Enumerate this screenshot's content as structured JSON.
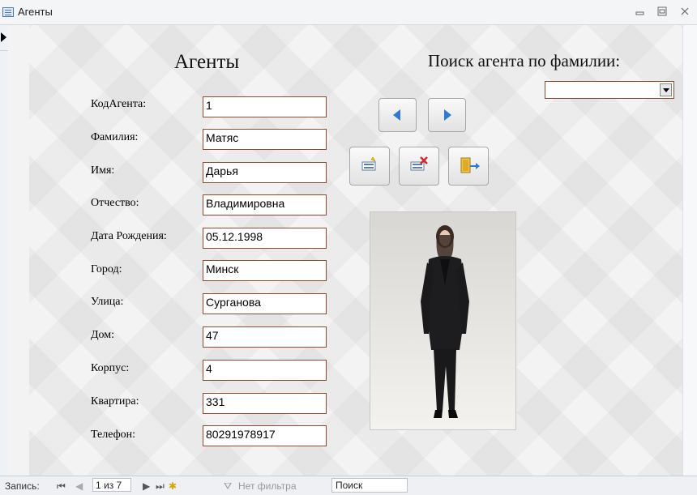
{
  "window": {
    "title": "Агенты"
  },
  "form": {
    "title": "Агенты",
    "search_label": "Поиск агента по фамилии:",
    "search_value": "",
    "fields": [
      {
        "label": "КодАгента:",
        "value": "1"
      },
      {
        "label": "Фамилия:",
        "value": "Матяс"
      },
      {
        "label": "Имя:",
        "value": "Дарья"
      },
      {
        "label": "Отчество:",
        "value": "Владимировна"
      },
      {
        "label": "Дата Рождения:",
        "value": "05.12.1998"
      },
      {
        "label": "Город:",
        "value": "Минск"
      },
      {
        "label": "Улица:",
        "value": "Сурганова"
      },
      {
        "label": "Дом:",
        "value": "47"
      },
      {
        "label": "Корпус:",
        "value": "4"
      },
      {
        "label": "Квартира:",
        "value": "331"
      },
      {
        "label": "Телефон:",
        "value": "80291978917"
      }
    ]
  },
  "status": {
    "record_label": "Запись:",
    "record_value": "1 из 7",
    "filter_label": "Нет фильтра",
    "search_label": "Поиск"
  },
  "colors": {
    "field_border": "#8c4b2d",
    "nav_arrow": "#2e7ad6"
  }
}
